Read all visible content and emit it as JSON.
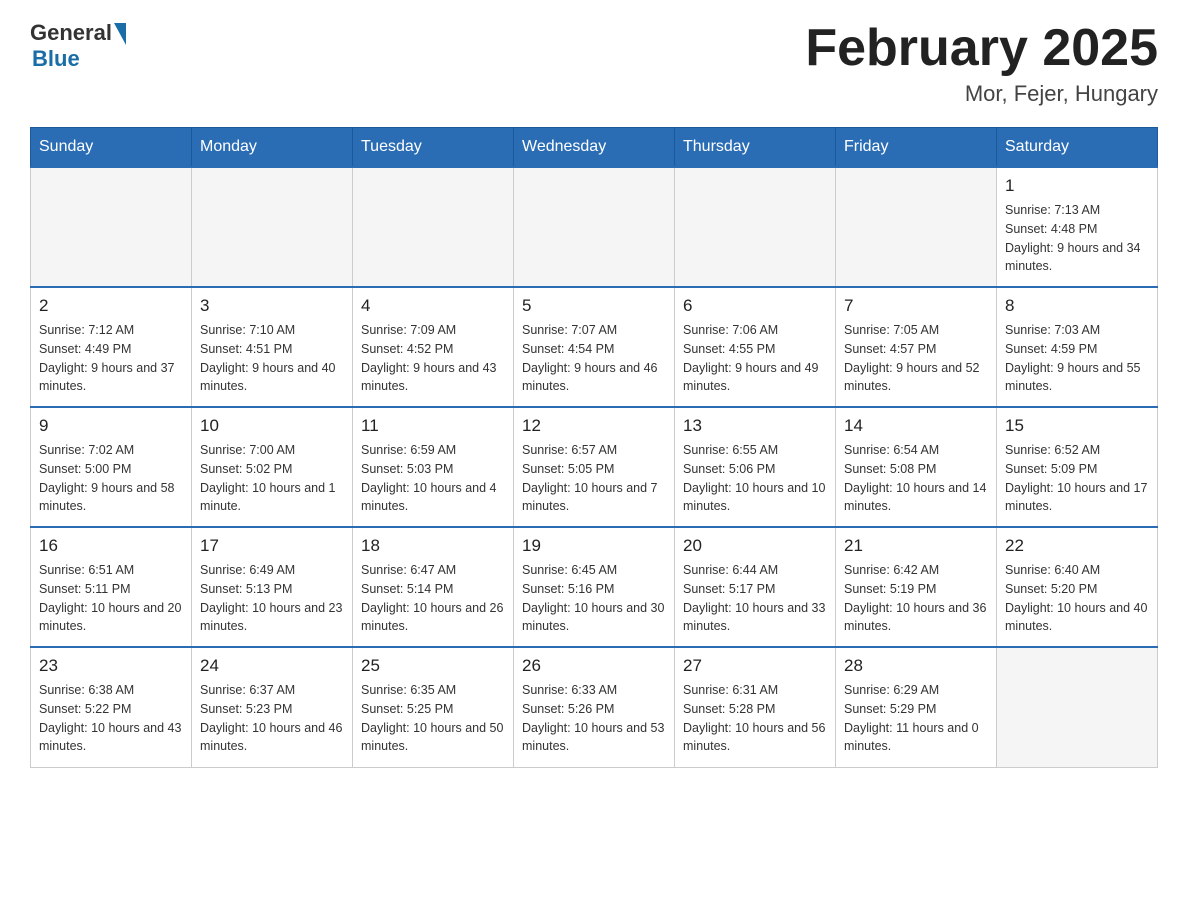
{
  "header": {
    "logo_general": "General",
    "logo_blue": "Blue",
    "title": "February 2025",
    "location": "Mor, Fejer, Hungary"
  },
  "days_of_week": [
    "Sunday",
    "Monday",
    "Tuesday",
    "Wednesday",
    "Thursday",
    "Friday",
    "Saturday"
  ],
  "weeks": [
    {
      "days": [
        {
          "num": "",
          "info": ""
        },
        {
          "num": "",
          "info": ""
        },
        {
          "num": "",
          "info": ""
        },
        {
          "num": "",
          "info": ""
        },
        {
          "num": "",
          "info": ""
        },
        {
          "num": "",
          "info": ""
        },
        {
          "num": "1",
          "info": "Sunrise: 7:13 AM\nSunset: 4:48 PM\nDaylight: 9 hours and 34 minutes."
        }
      ]
    },
    {
      "days": [
        {
          "num": "2",
          "info": "Sunrise: 7:12 AM\nSunset: 4:49 PM\nDaylight: 9 hours and 37 minutes."
        },
        {
          "num": "3",
          "info": "Sunrise: 7:10 AM\nSunset: 4:51 PM\nDaylight: 9 hours and 40 minutes."
        },
        {
          "num": "4",
          "info": "Sunrise: 7:09 AM\nSunset: 4:52 PM\nDaylight: 9 hours and 43 minutes."
        },
        {
          "num": "5",
          "info": "Sunrise: 7:07 AM\nSunset: 4:54 PM\nDaylight: 9 hours and 46 minutes."
        },
        {
          "num": "6",
          "info": "Sunrise: 7:06 AM\nSunset: 4:55 PM\nDaylight: 9 hours and 49 minutes."
        },
        {
          "num": "7",
          "info": "Sunrise: 7:05 AM\nSunset: 4:57 PM\nDaylight: 9 hours and 52 minutes."
        },
        {
          "num": "8",
          "info": "Sunrise: 7:03 AM\nSunset: 4:59 PM\nDaylight: 9 hours and 55 minutes."
        }
      ]
    },
    {
      "days": [
        {
          "num": "9",
          "info": "Sunrise: 7:02 AM\nSunset: 5:00 PM\nDaylight: 9 hours and 58 minutes."
        },
        {
          "num": "10",
          "info": "Sunrise: 7:00 AM\nSunset: 5:02 PM\nDaylight: 10 hours and 1 minute."
        },
        {
          "num": "11",
          "info": "Sunrise: 6:59 AM\nSunset: 5:03 PM\nDaylight: 10 hours and 4 minutes."
        },
        {
          "num": "12",
          "info": "Sunrise: 6:57 AM\nSunset: 5:05 PM\nDaylight: 10 hours and 7 minutes."
        },
        {
          "num": "13",
          "info": "Sunrise: 6:55 AM\nSunset: 5:06 PM\nDaylight: 10 hours and 10 minutes."
        },
        {
          "num": "14",
          "info": "Sunrise: 6:54 AM\nSunset: 5:08 PM\nDaylight: 10 hours and 14 minutes."
        },
        {
          "num": "15",
          "info": "Sunrise: 6:52 AM\nSunset: 5:09 PM\nDaylight: 10 hours and 17 minutes."
        }
      ]
    },
    {
      "days": [
        {
          "num": "16",
          "info": "Sunrise: 6:51 AM\nSunset: 5:11 PM\nDaylight: 10 hours and 20 minutes."
        },
        {
          "num": "17",
          "info": "Sunrise: 6:49 AM\nSunset: 5:13 PM\nDaylight: 10 hours and 23 minutes."
        },
        {
          "num": "18",
          "info": "Sunrise: 6:47 AM\nSunset: 5:14 PM\nDaylight: 10 hours and 26 minutes."
        },
        {
          "num": "19",
          "info": "Sunrise: 6:45 AM\nSunset: 5:16 PM\nDaylight: 10 hours and 30 minutes."
        },
        {
          "num": "20",
          "info": "Sunrise: 6:44 AM\nSunset: 5:17 PM\nDaylight: 10 hours and 33 minutes."
        },
        {
          "num": "21",
          "info": "Sunrise: 6:42 AM\nSunset: 5:19 PM\nDaylight: 10 hours and 36 minutes."
        },
        {
          "num": "22",
          "info": "Sunrise: 6:40 AM\nSunset: 5:20 PM\nDaylight: 10 hours and 40 minutes."
        }
      ]
    },
    {
      "days": [
        {
          "num": "23",
          "info": "Sunrise: 6:38 AM\nSunset: 5:22 PM\nDaylight: 10 hours and 43 minutes."
        },
        {
          "num": "24",
          "info": "Sunrise: 6:37 AM\nSunset: 5:23 PM\nDaylight: 10 hours and 46 minutes."
        },
        {
          "num": "25",
          "info": "Sunrise: 6:35 AM\nSunset: 5:25 PM\nDaylight: 10 hours and 50 minutes."
        },
        {
          "num": "26",
          "info": "Sunrise: 6:33 AM\nSunset: 5:26 PM\nDaylight: 10 hours and 53 minutes."
        },
        {
          "num": "27",
          "info": "Sunrise: 6:31 AM\nSunset: 5:28 PM\nDaylight: 10 hours and 56 minutes."
        },
        {
          "num": "28",
          "info": "Sunrise: 6:29 AM\nSunset: 5:29 PM\nDaylight: 11 hours and 0 minutes."
        },
        {
          "num": "",
          "info": ""
        }
      ]
    }
  ]
}
